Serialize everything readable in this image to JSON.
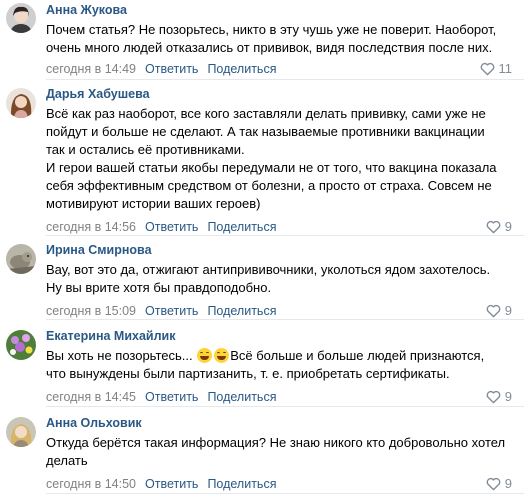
{
  "comments": [
    {
      "author": "Анна Жукова",
      "lines": [
        "Почем статья? Не позорьтесь, никто в эту чушь уже не поверит. Наоборот,",
        "очень много людей отказались от прививок, видя последствия после них."
      ],
      "time": "сегодня в 14:49",
      "reply": "Ответить",
      "share": "Поделиться",
      "likes": "11",
      "avatar_icon": "avatar-photo-woman-dark-hair"
    },
    {
      "author": "Дарья Хабушева",
      "lines": [
        "Всё как раз наоборот, все кого заставляли делать прививку, сами уже не",
        "пойдут и больше не сделают. А так называемые противники вакцинации",
        "так и остались её противниками.",
        "И герои вашей статьи якобы передумали не от того, что вакцина показала",
        "себя эффективным средством от болезни, а просто от страха. Совсем не",
        "мотивируют истории ваших героев)"
      ],
      "time": "сегодня в 14:56",
      "reply": "Ответить",
      "share": "Поделиться",
      "likes": "9",
      "avatar_icon": "avatar-photo-woman-brown-hair"
    },
    {
      "author": "Ирина Смирнова",
      "lines": [
        "Вау, вот это да, отжигают антипрививочники, уколоться ядом захотелось.",
        "Ну вы врите хотя бы правдоподобно."
      ],
      "time": "сегодня в 15:09",
      "reply": "Ответить",
      "share": "Поделиться",
      "likes": "9",
      "avatar_icon": "avatar-photo-animal"
    },
    {
      "author": "Екатерина Михайлик",
      "line1_before": "Вы хоть не позорьтесь... ",
      "line1_after": "Всё больше и больше людей признаются,",
      "line2": "что вынуждены были партизанить, т. е. приобретать сертификаты.",
      "emoji_icon": "laughing-tears-emoji-icon",
      "time": "сегодня в 14:45",
      "reply": "Ответить",
      "share": "Поделиться",
      "likes": "9",
      "avatar_icon": "avatar-photo-flowers"
    },
    {
      "author": "Анна Ольховик",
      "lines": [
        "Откуда берётся такая информация? Не знаю никого кто добровольно хотел",
        "делать"
      ],
      "time": "сегодня в 14:50",
      "reply": "Ответить",
      "share": "Поделиться",
      "likes": "9",
      "avatar_icon": "avatar-photo-woman-blonde"
    }
  ],
  "colors": {
    "author": "#2a5885",
    "link": "#2a5885",
    "meta": "#828282",
    "separator": "#e7e8ec",
    "like_icon": "#818c99"
  },
  "icons": {
    "like": "heart-outline-icon"
  }
}
